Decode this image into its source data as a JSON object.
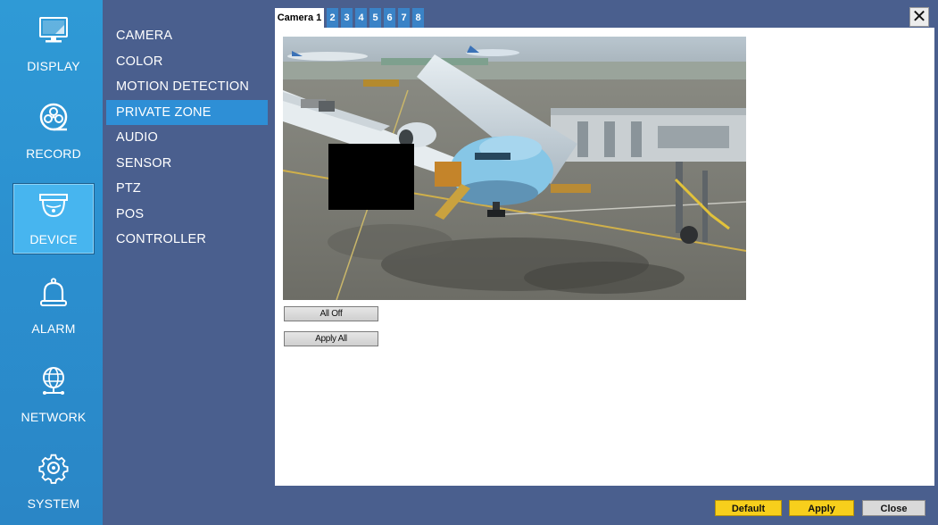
{
  "nav": {
    "items": [
      {
        "label": "DISPLAY",
        "icon": "monitor-icon"
      },
      {
        "label": "RECORD",
        "icon": "record-reel-icon"
      },
      {
        "label": "DEVICE",
        "icon": "dome-camera-icon",
        "active": true
      },
      {
        "label": "ALARM",
        "icon": "bell-icon"
      },
      {
        "label": "NETWORK",
        "icon": "globe-network-icon"
      },
      {
        "label": "SYSTEM",
        "icon": "gear-icon"
      }
    ]
  },
  "submenu": {
    "items": [
      {
        "label": "CAMERA"
      },
      {
        "label": "COLOR"
      },
      {
        "label": "MOTION DETECTION"
      },
      {
        "label": "PRIVATE ZONE",
        "active": true
      },
      {
        "label": "AUDIO"
      },
      {
        "label": "SENSOR"
      },
      {
        "label": "PTZ"
      },
      {
        "label": "POS"
      },
      {
        "label": "CONTROLLER"
      }
    ]
  },
  "tabs": [
    "Camera 1",
    "2",
    "3",
    "4",
    "5",
    "6",
    "7",
    "8"
  ],
  "close_icon": "close-icon",
  "panel": {
    "preview_icon": "camera-preview-image",
    "all_off_label": "All Off",
    "apply_all_label": "Apply All"
  },
  "footer": {
    "default_label": "Default",
    "apply_label": "Apply",
    "close_label": "Close"
  },
  "colors": {
    "background": "#4a5f8e",
    "rail": "#2b8fcf",
    "active_submenu": "#2e8fd6",
    "tab": "#3a83c7",
    "accent_button": "#f7cf1c"
  }
}
